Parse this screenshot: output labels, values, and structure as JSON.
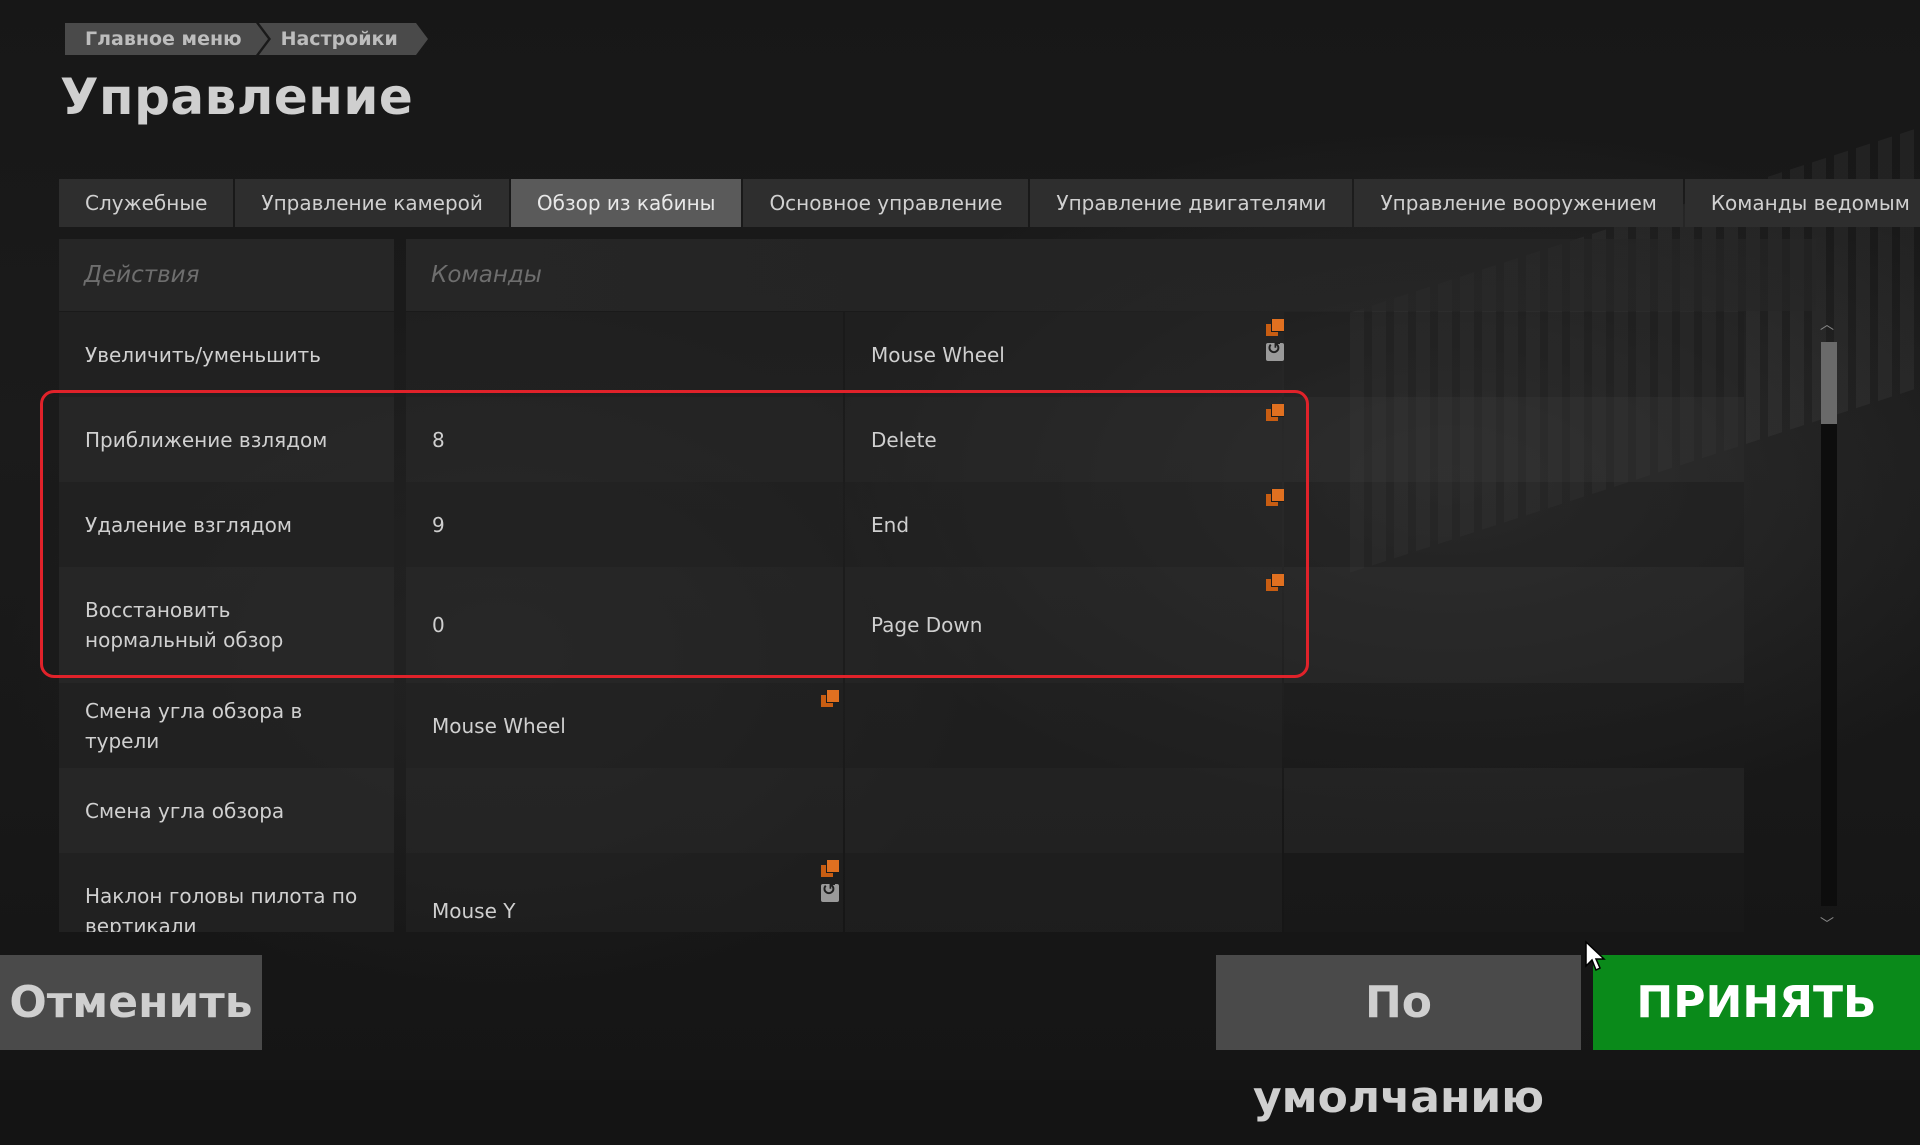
{
  "breadcrumb": [
    "Главное меню",
    "Настройки"
  ],
  "page_title": "Управление",
  "tabs": [
    {
      "label": "Служебные",
      "active": false
    },
    {
      "label": "Управление камерой",
      "active": false
    },
    {
      "label": "Обзор из кабины",
      "active": true
    },
    {
      "label": "Основное управление",
      "active": false
    },
    {
      "label": "Управление двигателями",
      "active": false
    },
    {
      "label": "Управление вооружением",
      "active": false
    },
    {
      "label": "Команды ведомым",
      "active": false
    }
  ],
  "table": {
    "header_actions": "Действия",
    "header_commands": "Команды",
    "rows": [
      {
        "action": "Увеличить/уменьшить",
        "key1": "",
        "key2": "Mouse Wheel",
        "key3": ""
      },
      {
        "action": "Приближение взлядом",
        "key1": "8",
        "key2": "Delete",
        "key3": ""
      },
      {
        "action": "Удаление взглядом",
        "key1": "9",
        "key2": "End",
        "key3": ""
      },
      {
        "action": "Восстановить нормальный обзор",
        "key1": "0",
        "key2": "Page Down",
        "key3": ""
      },
      {
        "action": "Смена угла обзора в турели",
        "key1": "Mouse Wheel",
        "key2": "",
        "key3": ""
      },
      {
        "action": "Смена угла обзора",
        "key1": "",
        "key2": "",
        "key3": ""
      },
      {
        "action": "Наклон головы пилота по вертикали",
        "key1": "Mouse Y",
        "key2": "",
        "key3": ""
      }
    ]
  },
  "buttons": {
    "cancel": "Отменить",
    "default": "По умолчанию",
    "accept": "ПРИНЯТЬ"
  },
  "colors": {
    "accent_orange": "#e07020",
    "highlight_red": "#e0222a",
    "accept_green": "#0a8a1a"
  }
}
